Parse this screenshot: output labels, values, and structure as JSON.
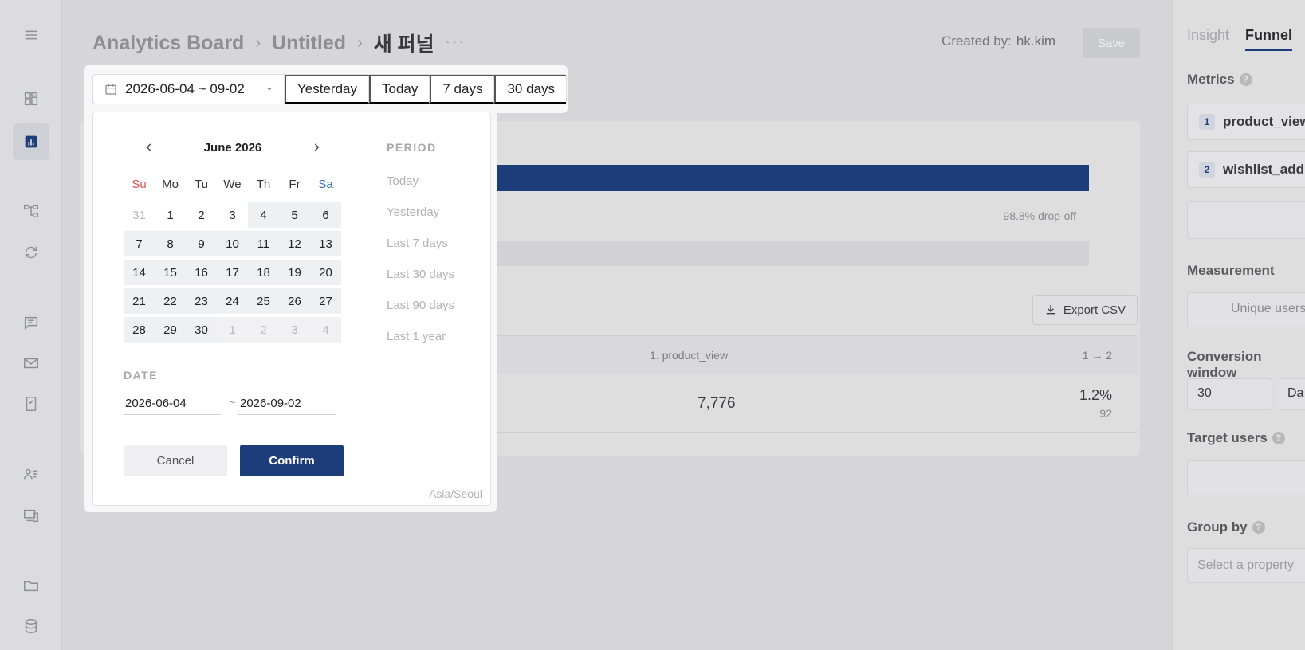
{
  "nav": {
    "icons": [
      "dashboard-icon",
      "chart-icon",
      "flow-icon",
      "retention-icon",
      "message-icon",
      "mail-icon",
      "document-icon",
      "user-list-icon",
      "devices-icon",
      "folder-icon",
      "database-icon"
    ]
  },
  "header": {
    "breadcrumb": [
      "Analytics Board",
      "Untitled",
      "새 퍼널"
    ],
    "more": "···",
    "created_label": "Created by:",
    "created_by": "hk.kim",
    "save_label": "Save"
  },
  "funnel": {
    "dropoff": "98.8% drop-off",
    "export_label": "Export CSV",
    "table": {
      "headers": [
        "1. product_view",
        "1 → 2"
      ],
      "row": {
        "count": "7,776",
        "conversion": "1.2%",
        "converted": "92"
      }
    }
  },
  "right_panel": {
    "tabs": [
      "Insight",
      "Funnel"
    ],
    "metrics_label": "Metrics",
    "metrics": [
      {
        "num": "1",
        "name": "product_view"
      },
      {
        "num": "2",
        "name": "wishlist_add"
      }
    ],
    "measurement_label": "Measurement",
    "measurement_value": "Unique users",
    "conversion_label": "Conversion window",
    "conversion_value": "30",
    "conversion_unit": "Da",
    "target_label": "Target users",
    "add": "+",
    "group_label": "Group by",
    "group_placeholder": "Select a property"
  },
  "picker": {
    "range_label": "2026-06-04 ~ 09-02",
    "quick": [
      "Yesterday",
      "Today",
      "7 days",
      "30 days"
    ],
    "month_title": "June 2026",
    "dow": [
      "Su",
      "Mo",
      "Tu",
      "We",
      "Th",
      "Fr",
      "Sa"
    ],
    "days": [
      [
        "31",
        "muted"
      ],
      [
        "1",
        ""
      ],
      [
        "2",
        ""
      ],
      [
        "3",
        ""
      ],
      [
        "4",
        "inrange"
      ],
      [
        "5",
        "inrange"
      ],
      [
        "6",
        "inrange"
      ],
      [
        "7",
        "inrange"
      ],
      [
        "8",
        "inrange"
      ],
      [
        "9",
        "inrange"
      ],
      [
        "10",
        "inrange"
      ],
      [
        "11",
        "inrange"
      ],
      [
        "12",
        "inrange"
      ],
      [
        "13",
        "inrange"
      ],
      [
        "14",
        "inrange"
      ],
      [
        "15",
        "inrange"
      ],
      [
        "16",
        "inrange"
      ],
      [
        "17",
        "inrange"
      ],
      [
        "18",
        "inrange"
      ],
      [
        "19",
        "inrange"
      ],
      [
        "20",
        "inrange"
      ],
      [
        "21",
        "inrange"
      ],
      [
        "22",
        "inrange"
      ],
      [
        "23",
        "inrange"
      ],
      [
        "24",
        "inrange"
      ],
      [
        "25",
        "inrange"
      ],
      [
        "26",
        "inrange"
      ],
      [
        "27",
        "inrange"
      ],
      [
        "28",
        "inrange"
      ],
      [
        "29",
        "inrange"
      ],
      [
        "30",
        "inrange"
      ],
      [
        "1",
        "out"
      ],
      [
        "2",
        "out"
      ],
      [
        "3",
        "out"
      ],
      [
        "4",
        "out"
      ]
    ],
    "date_label": "DATE",
    "start_date": "2026-06-04",
    "tilde": "~",
    "end_date": "2026-09-02",
    "cancel_label": "Cancel",
    "confirm_label": "Confirm",
    "period_label": "PERIOD",
    "periods": [
      "Today",
      "Yesterday",
      "Last 7 days",
      "Last 30 days",
      "Last 90 days",
      "Last 1 year"
    ],
    "timezone": "Asia/Seoul"
  },
  "colors": {
    "accent": "#1c3d7a",
    "sunday": "#d9534f",
    "saturday": "#3b6fb6"
  }
}
